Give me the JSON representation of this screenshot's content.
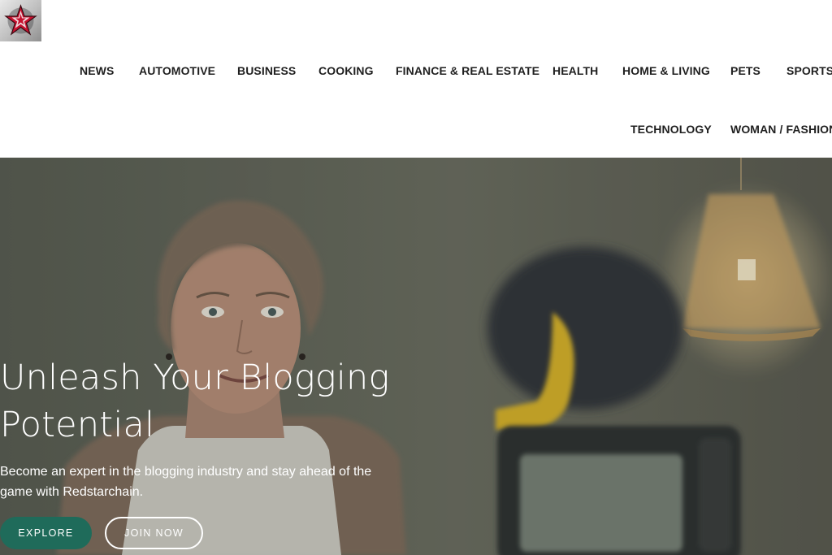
{
  "brand": {
    "logo_icon": "red-star-logo",
    "colors": {
      "accent": "#1f6b5a",
      "nav_text": "#1f1f1f",
      "hero_text": "#ffffff"
    }
  },
  "nav": {
    "items": [
      {
        "label": "NEWS"
      },
      {
        "label": "AUTOMOTIVE"
      },
      {
        "label": "BUSINESS"
      },
      {
        "label": "COOKING"
      },
      {
        "label": "FINANCE & REAL ESTATE"
      },
      {
        "label": "HEALTH"
      },
      {
        "label": "HOME & LIVING"
      },
      {
        "label": "PETS"
      },
      {
        "label": "SPORTS"
      },
      {
        "label": "TECHNOLOGY"
      },
      {
        "label": "WOMAN / FASHION"
      }
    ]
  },
  "hero": {
    "title": "Unleash Your Blogging Potential",
    "subtitle": "Become an expert in the blogging industry and stay ahead of the game with Redstarchain.",
    "explore_label": "EXPLORE",
    "join_label": "JOIN NOW"
  }
}
